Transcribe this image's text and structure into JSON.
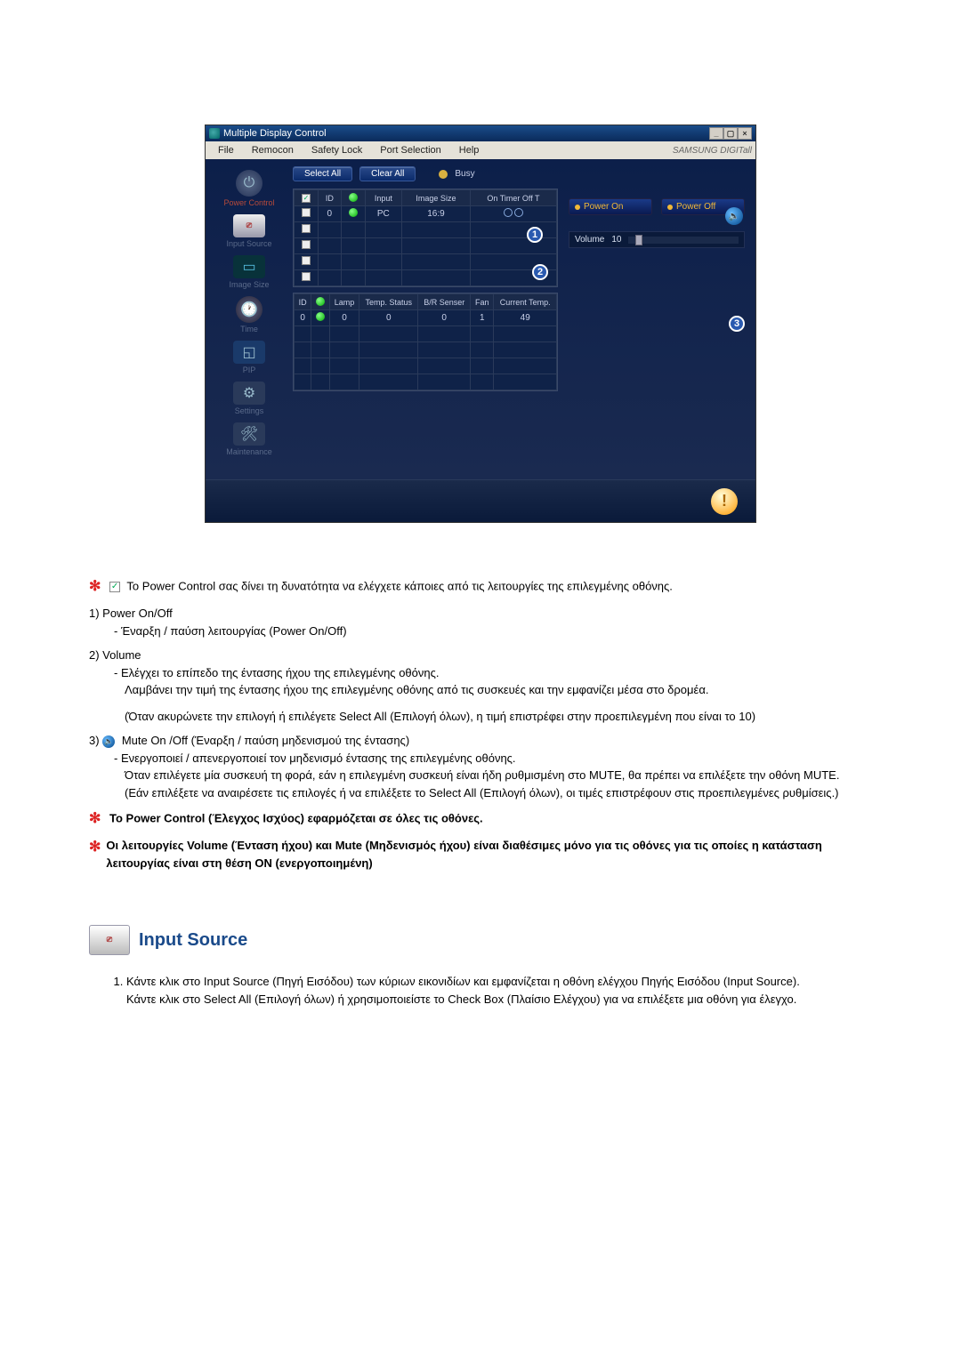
{
  "app": {
    "title": "Multiple Display Control",
    "menu": [
      "File",
      "Remocon",
      "Safety Lock",
      "Port Selection",
      "Help"
    ],
    "brand": "SAMSUNG DIGITall"
  },
  "sidebar": {
    "items": [
      {
        "label": "Power Control",
        "active": true
      },
      {
        "label": "Input Source"
      },
      {
        "label": "Image Size"
      },
      {
        "label": "Time"
      },
      {
        "label": "PIP"
      },
      {
        "label": "Settings"
      },
      {
        "label": "Maintenance"
      }
    ]
  },
  "toolbar": {
    "select_all": "Select All",
    "clear_all": "Clear All",
    "busy": "Busy"
  },
  "table1": {
    "headers": [
      "☑",
      "ID",
      "●",
      "Input",
      "Image Size",
      "On Timer Off T"
    ],
    "row": {
      "id": "0",
      "input": "PC",
      "image_size": "16:9"
    }
  },
  "table2": {
    "headers": [
      "ID",
      "●",
      "Lamp",
      "Temp. Status",
      "B/R Senser",
      "Fan",
      "Current Temp."
    ],
    "row": {
      "id": "0",
      "lamp": "0",
      "temp_status": "0",
      "sensor": "0",
      "fan": "1",
      "cur_temp": "49"
    }
  },
  "panel": {
    "power_on": "Power On",
    "power_off": "Power Off",
    "volume_label": "Volume",
    "volume_value": "10"
  },
  "callouts": {
    "c1": "1",
    "c2": "2",
    "c3": "3"
  },
  "doc": {
    "intro": "Το Power Control σας δίνει τη δυνατότητα να ελέγχετε κάποιες από τις λειτουργίες της επιλεγμένης οθόνης.",
    "i1_label": "1)  Power On/Off",
    "i1_sub": "- Έναρξη / παύση λειτουργίας (Power On/Off)",
    "i2_label": "2)  Volume",
    "i2_sub1": "- Ελέγχει το επίπεδο της έντασης ήχου της επιλεγμένης οθόνης.",
    "i2_sub2": "Λαμβάνει την τιμή της έντασης ήχου της επιλεγμένης οθόνης από τις συσκευές και την εμφανίζει μέσα στο δρομέα.",
    "i2_sub3": "(Όταν ακυρώνετε την επιλογή ή επιλέγετε Select All (Επιλογή όλων), η τιμή επιστρέφει στην προεπιλεγμένη που είναι το 10)",
    "i3_num": "3)",
    "i3_label": "Mute On /Off (Έναρξη / παύση μηδενισμού της έντασης)",
    "i3_sub1": "- Ενεργοποιεί / απενεργοποιεί τον μηδενισμό έντασης της επιλεγμένης οθόνης.",
    "i3_sub2": "Όταν επιλέγετε μία συσκευή τη φορά, εάν η επιλεγμένη συσκευή είναι ήδη ρυθμισμένη στο MUTE, θα πρέπει να επιλέξετε την οθόνη MUTE.",
    "i3_sub3": "(Εάν επιλέξετε να αναιρέσετε τις επιλογές ή να επιλέξετε το Select All (Επιλογή όλων), οι τιμές επιστρέφουν στις προεπιλεγμένες ρυθμίσεις.)",
    "note1": "Το Power Control (Έλεγχος Ισχύος) εφαρμόζεται σε όλες τις οθόνες.",
    "note2": "Οι λειτουργίες Volume (Ένταση ήχου) και Mute (Μηδενισμός ήχου) είναι διαθέσιμες μόνο για τις οθόνες για τις οποίες η κατάσταση λειτουργίας είναι στη θέση ON (ενεργοποιημένη)",
    "section_title": "Input Source",
    "instr1": "Κάντε κλικ στο Input Source (Πηγή Εισόδου) των κύριων εικονιδίων και εμφανίζεται η οθόνη ελέγχου Πηγής Εισόδου (Input Source).",
    "instr1b": "Κάντε κλικ στο Select All (Επιλογή όλων) ή χρησιμοποιείστε το Check Box (Πλαίσιο Ελέγχου) για να επιλέξετε μια οθόνη για έλεγχο."
  }
}
